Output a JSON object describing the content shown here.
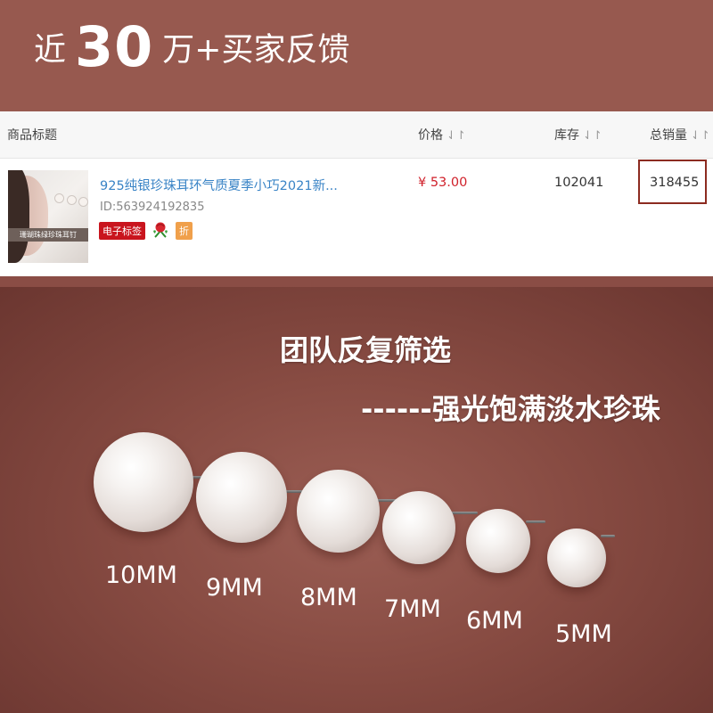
{
  "banner": {
    "prefix": "近",
    "number": "30",
    "suffix": "万+买家反馈"
  },
  "table": {
    "headers": {
      "title": "商品标题",
      "price": "价格",
      "stock": "库存",
      "sales": "总销量",
      "sort_icon": "⇃↾"
    },
    "row": {
      "thumbnail_caption": "珊瑚珠绿珍珠耳钉",
      "title": "925纯银珍珠耳环气质夏季小巧2021新...",
      "id": "ID:563924192835",
      "tag_label": "电子标签",
      "rose_icon": "rose-icon",
      "discount_label": "折",
      "price": "¥ 53.00",
      "stock": "102041",
      "sales": "318455"
    }
  },
  "photo": {
    "headline1": "团队反复筛选",
    "headline2": "------强光饱满淡水珍珠",
    "sizes": [
      "10MM",
      "9MM",
      "8MM",
      "7MM",
      "6MM",
      "5MM"
    ]
  },
  "colors": {
    "banner_bg": "#97594f",
    "link": "#3a84c6",
    "price": "#d0212b",
    "tag_red": "#c9151e",
    "tag_orange": "#f0a04b",
    "highlight_border": "#8c2b20"
  }
}
